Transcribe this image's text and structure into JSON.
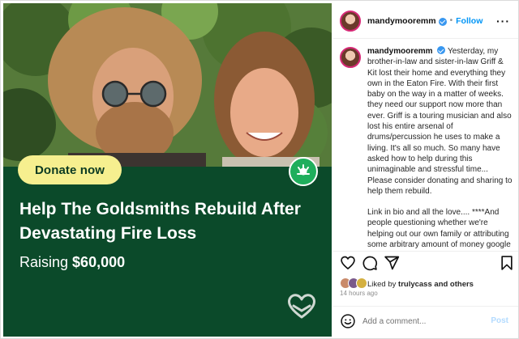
{
  "media": {
    "donate_label": "Donate now",
    "headline": "Help The Goldsmiths Rebuild After Devastating Fire Loss",
    "raising_prefix": "Raising",
    "raising_amount": "$60,000",
    "colors": {
      "panel": "#0b4a2a",
      "pill": "#f6ef8f",
      "badge": "#1fae5c"
    },
    "icons": [
      "gofundme-badge-icon",
      "heart-hands-icon"
    ]
  },
  "post": {
    "username": "mandymooremm",
    "separator": "•",
    "follow_label": "Follow",
    "more_label": "···",
    "caption_paragraphs": [
      "Yesterday, my brother-in-law and sister-in-law Griff & Kit lost their home and everything they own in the Eaton Fire. With their first baby on the way in a matter of weeks. they need our support now more than ever. Griff is a touring musician and also lost his entire arsenal of drums/percussion he uses to make a living. It's all so much. So many have asked how to help during this unimaginable and stressful time... Please consider donating and sharing to help them rebuild.",
      "Link in bio and all the love.... ****And people questioning whether we're helping out our own family or attributing some arbitrary amount of money google says someone has is"
    ],
    "liked_by_prefix": "Liked by",
    "liked_by_user": "trulycass",
    "liked_by_suffix": "and others",
    "time_ago": "14 hours ago",
    "comment_placeholder": "Add a comment...",
    "post_label": "Post",
    "icons": [
      "heart-icon",
      "comment-icon",
      "share-icon",
      "bookmark-icon",
      "emoji-icon",
      "verified-icon"
    ]
  }
}
